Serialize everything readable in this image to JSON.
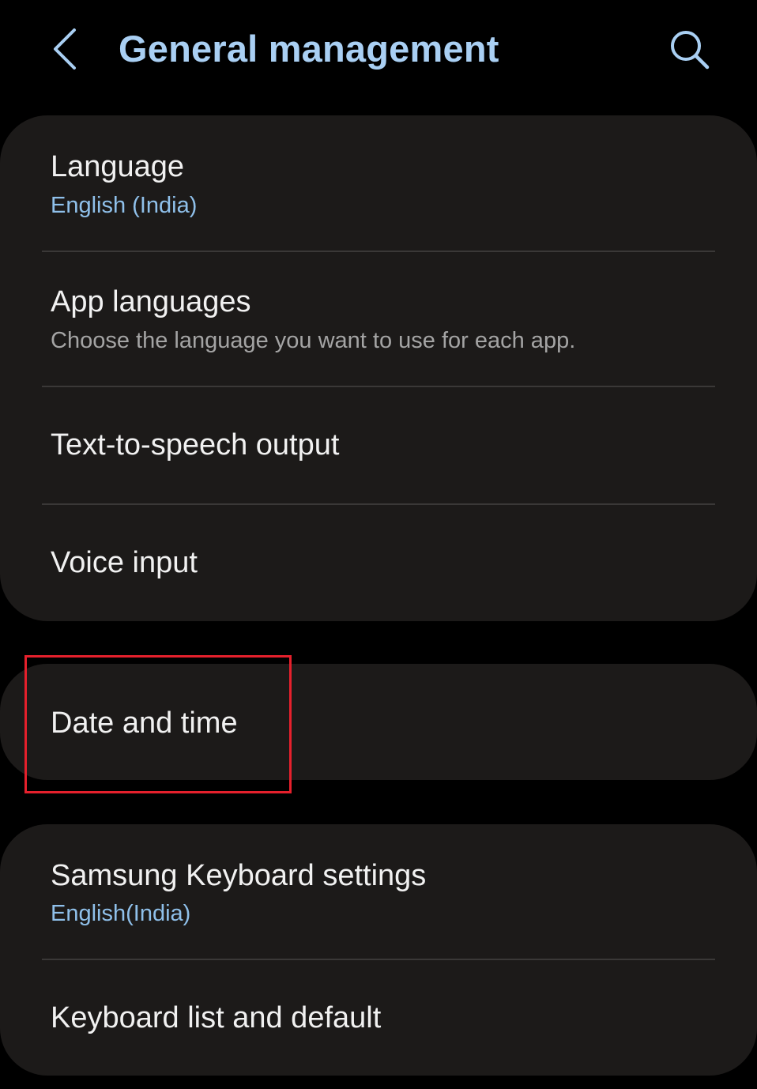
{
  "header": {
    "title": "General management",
    "back_icon": "chevron-left-icon",
    "search_icon": "search-icon"
  },
  "groups": [
    {
      "items": [
        {
          "title": "Language",
          "subtitle": "English (India)"
        },
        {
          "title": "App languages",
          "subtitle": "Choose the language you want to use for each app."
        },
        {
          "title": "Text-to-speech output"
        },
        {
          "title": "Voice input"
        }
      ]
    },
    {
      "items": [
        {
          "title": "Date and time"
        }
      ]
    },
    {
      "items": [
        {
          "title": "Samsung Keyboard settings",
          "subtitle": "English(India)"
        },
        {
          "title": "Keyboard list and default"
        }
      ]
    }
  ],
  "colors": {
    "background": "#000000",
    "card": "#1c1a19",
    "title_accent": "#a9cff3",
    "subtitle_accent": "#8fc0ea",
    "highlight_box": "#e5202c"
  }
}
